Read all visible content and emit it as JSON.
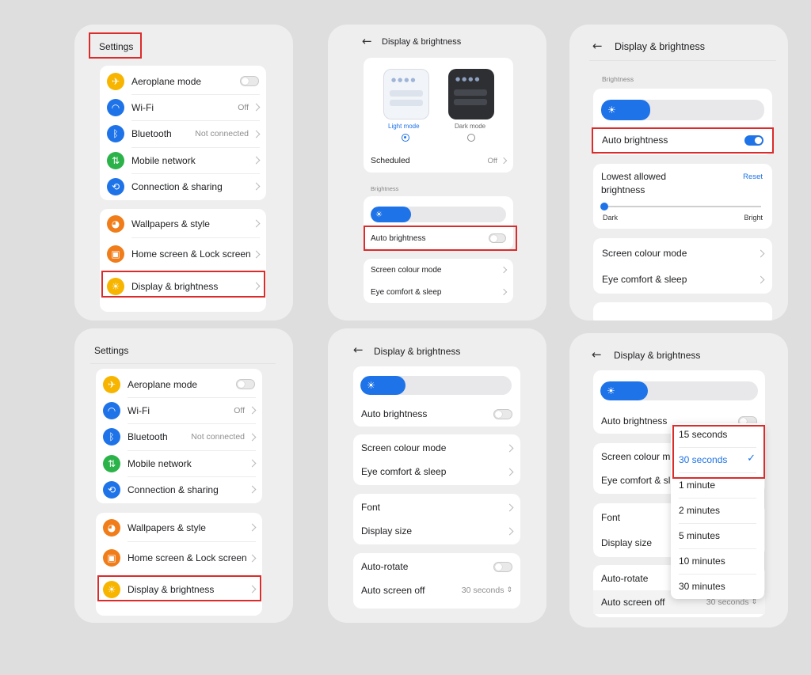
{
  "settings": {
    "title": "Settings",
    "items": {
      "aeroplane": "Aeroplane mode",
      "wifi": "Wi-Fi",
      "wifi_value": "Off",
      "bluetooth": "Bluetooth",
      "bluetooth_value": "Not connected",
      "mobile": "Mobile network",
      "connection": "Connection & sharing",
      "wallpapers": "Wallpapers & style",
      "home_lock": "Home screen & Lock screen",
      "display": "Display & brightness"
    }
  },
  "display": {
    "title": "Display & brightness",
    "light_mode": "Light mode",
    "dark_mode": "Dark mode",
    "scheduled": "Scheduled",
    "scheduled_value": "Off",
    "brightness_section": "Brightness",
    "brightness_level": 0.3,
    "auto_brightness": "Auto brightness",
    "lowest_allowed": "Lowest allowed brightness",
    "reset": "Reset",
    "dark": "Dark",
    "bright": "Bright",
    "screen_colour_mode": "Screen colour mode",
    "eye_comfort": "Eye comfort & sleep",
    "font": "Font",
    "display_size": "Display size",
    "auto_rotate": "Auto-rotate",
    "auto_screen_off": "Auto screen off",
    "auto_screen_off_value": "30 seconds",
    "screen_colour_mode_trunc": "Screen colour m",
    "eye_comfort_trunc": "Eye comfort & sl"
  },
  "dropdown": {
    "options": [
      "15 seconds",
      "30 seconds",
      "1 minute",
      "2 minutes",
      "5 minutes",
      "10 minutes",
      "30 minutes"
    ],
    "selected": "30 seconds"
  },
  "colors": {
    "accent": "#1f73e8",
    "highlight": "#dc2b2b"
  }
}
